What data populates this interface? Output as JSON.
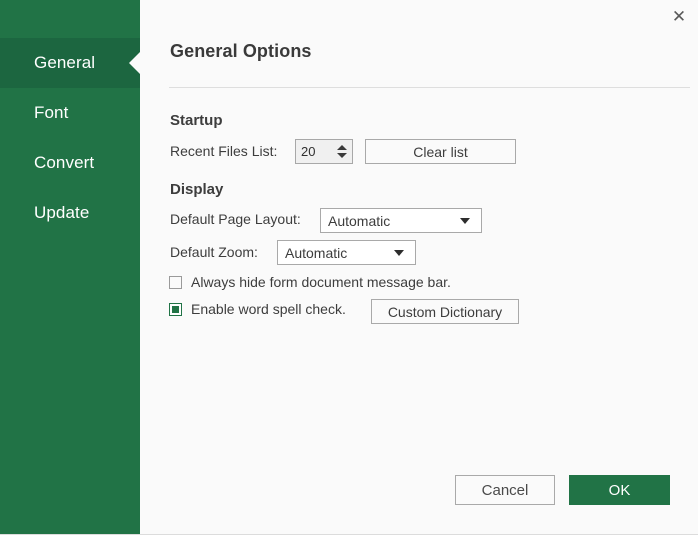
{
  "dialog": {
    "title": "General Options",
    "close_icon": "close-icon",
    "accent_color": "#217346",
    "selected_nav_color": "#1c6640",
    "panel_background": "#fafafa"
  },
  "sidebar": {
    "items": [
      {
        "label": "General",
        "selected": true
      },
      {
        "label": "Font",
        "selected": false
      },
      {
        "label": "Convert",
        "selected": false
      },
      {
        "label": "Update",
        "selected": false
      }
    ]
  },
  "sections": {
    "startup": {
      "heading": "Startup",
      "recent_files_label": "Recent Files List:",
      "recent_files_value": "20",
      "spinner_up_icon": "triangle-up-icon",
      "spinner_down_icon": "triangle-down-icon",
      "clear_list_label": "Clear list"
    },
    "display": {
      "heading": "Display",
      "page_layout_label": "Default Page Layout:",
      "page_layout_value": "Automatic",
      "page_layout_options": [
        "Automatic"
      ],
      "zoom_label": "Default Zoom:",
      "zoom_value": "Automatic",
      "zoom_options": [
        "Automatic"
      ],
      "caret_icon": "chevron-down-icon",
      "hide_message_bar_label": "Always hide form document message bar.",
      "hide_message_bar_checked": false,
      "spell_check_label": "Enable word spell check.",
      "spell_check_checked": true,
      "custom_dictionary_label": "Custom Dictionary"
    }
  },
  "footer": {
    "cancel_label": "Cancel",
    "ok_label": "OK"
  }
}
